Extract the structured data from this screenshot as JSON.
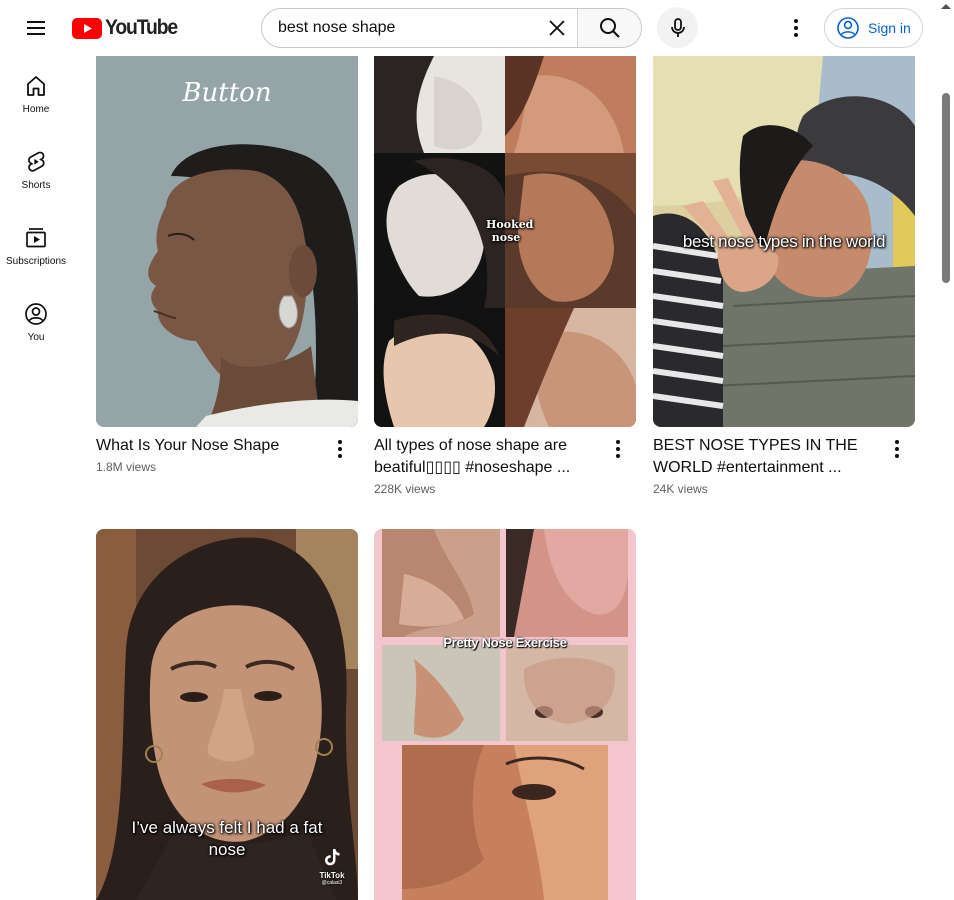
{
  "header": {
    "logo_text": "YouTube",
    "search_value": "best nose shape",
    "signin_label": "Sign in"
  },
  "sidebar": {
    "items": [
      {
        "label": "Home",
        "icon": "home-icon"
      },
      {
        "label": "Shorts",
        "icon": "shorts-icon"
      },
      {
        "label": "Subscriptions",
        "icon": "subscriptions-icon"
      },
      {
        "label": "You",
        "icon": "you-icon"
      }
    ]
  },
  "videos": [
    {
      "title": "What Is Your Nose Shape",
      "views": "1.8M views",
      "overlay": "Button"
    },
    {
      "title": "All types of nose shape are beatiful▯▯▯▯ #noseshape ...",
      "views": "228K views",
      "overlay": "Hooked nose"
    },
    {
      "title": "BEST NOSE TYPES IN THE WORLD #entertainment ...",
      "views": "24K views",
      "overlay": "best nose types in the world"
    },
    {
      "title": "",
      "views": "",
      "overlay": "I’ve always felt I had a fat nose",
      "watermark": "TikTok",
      "watermark_user": "@calasi3"
    },
    {
      "title": "",
      "views": "",
      "overlay": "Pretty Nose Exercise"
    }
  ],
  "colors": {
    "brand_red": "#ff0000",
    "link_blue": "#065fd4",
    "secondary_text": "#606060"
  }
}
